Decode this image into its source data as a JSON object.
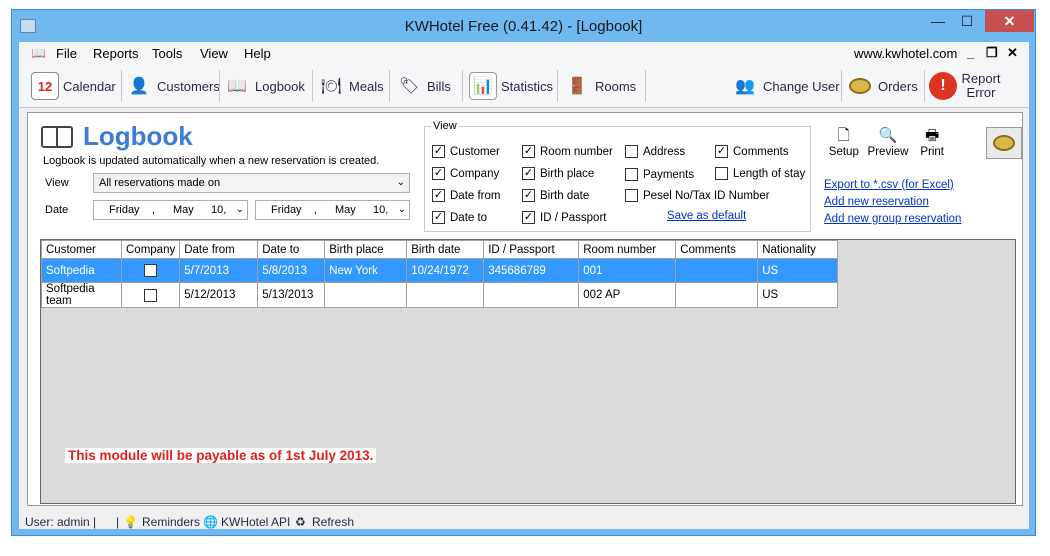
{
  "window": {
    "title": "KWHotel Free (0.41.42) - [Logbook]",
    "min": "—",
    "max": "☐",
    "close": "✕"
  },
  "menu": {
    "items": [
      "File",
      "Reports",
      "Tools",
      "View",
      "Help"
    ],
    "website": "www.kwhotel.com",
    "mdi_min": "_",
    "mdi_restore": "❐",
    "mdi_close": "✕"
  },
  "toolbar": {
    "items": [
      "Calendar",
      "Customers",
      "Logbook",
      "Meals",
      "Bills",
      "Statistics",
      "Rooms"
    ],
    "change_user": "Change User",
    "orders": "Orders",
    "report_error": "Report Error",
    "calendar_day": "12"
  },
  "page": {
    "title": "Logbook",
    "note": "Logbook is updated automatically when a new reservation is created."
  },
  "filters": {
    "view_label": "View",
    "view_value": "All reservations made on",
    "date_label": "Date",
    "date_from": {
      "day": "Friday",
      "sep": ",",
      "month": "May",
      "num": "10,"
    },
    "date_to": {
      "day": "Friday",
      "sep": ",",
      "month": "May",
      "num": "10,"
    }
  },
  "view_group": {
    "title": "View",
    "options": [
      {
        "label": "Customer",
        "checked": true
      },
      {
        "label": "Room number",
        "checked": true
      },
      {
        "label": "Address",
        "checked": false
      },
      {
        "label": "Comments",
        "checked": true
      },
      {
        "label": "Company",
        "checked": true
      },
      {
        "label": "Birth place",
        "checked": true
      },
      {
        "label": "Payments",
        "checked": false
      },
      {
        "label": "Length of stay",
        "checked": false
      },
      {
        "label": "Date from",
        "checked": true
      },
      {
        "label": "Birth date",
        "checked": true
      },
      {
        "label": "Pesel No/Tax ID Number",
        "checked": false
      },
      {
        "label": "Date to",
        "checked": true
      },
      {
        "label": "ID / Passport",
        "checked": true
      }
    ],
    "save_default": "Save as default"
  },
  "actions": {
    "setup": "Setup",
    "preview": "Preview",
    "print": "Print"
  },
  "links": {
    "export": "Export to *.csv (for Excel)",
    "add_reservation": "Add new reservation",
    "add_group": "Add new group reservation"
  },
  "table": {
    "columns": [
      "Customer",
      "Company",
      "Date from",
      "Date to",
      "Birth place",
      "Birth date",
      "ID / Passport",
      "Room number",
      "Comments",
      "Nationality"
    ],
    "rows": [
      {
        "customer": "Softpedia",
        "company": false,
        "date_from": "5/7/2013",
        "date_to": "5/8/2013",
        "birth_place": "New York",
        "birth_date": "10/24/1972",
        "id_passport": "345686789",
        "room": "001",
        "comments": "",
        "nationality": "US"
      },
      {
        "customer": "Softpedia team",
        "company": false,
        "date_from": "5/12/2013",
        "date_to": "5/13/2013",
        "birth_place": "",
        "birth_date": "",
        "id_passport": "",
        "room": "002 AP",
        "comments": "",
        "nationality": "US"
      }
    ],
    "selected_row": 0
  },
  "notice": "This module will be payable as of 1st July 2013.",
  "status": {
    "user": "User: admin |",
    "divider": "|",
    "reminders": "Reminders",
    "api": "KWHotel API",
    "refresh": "Refresh"
  },
  "colors": {
    "accent": "#3c7bd6",
    "selection": "#3399ff",
    "notice": "#e02020",
    "frame": "#6fb8f0"
  }
}
